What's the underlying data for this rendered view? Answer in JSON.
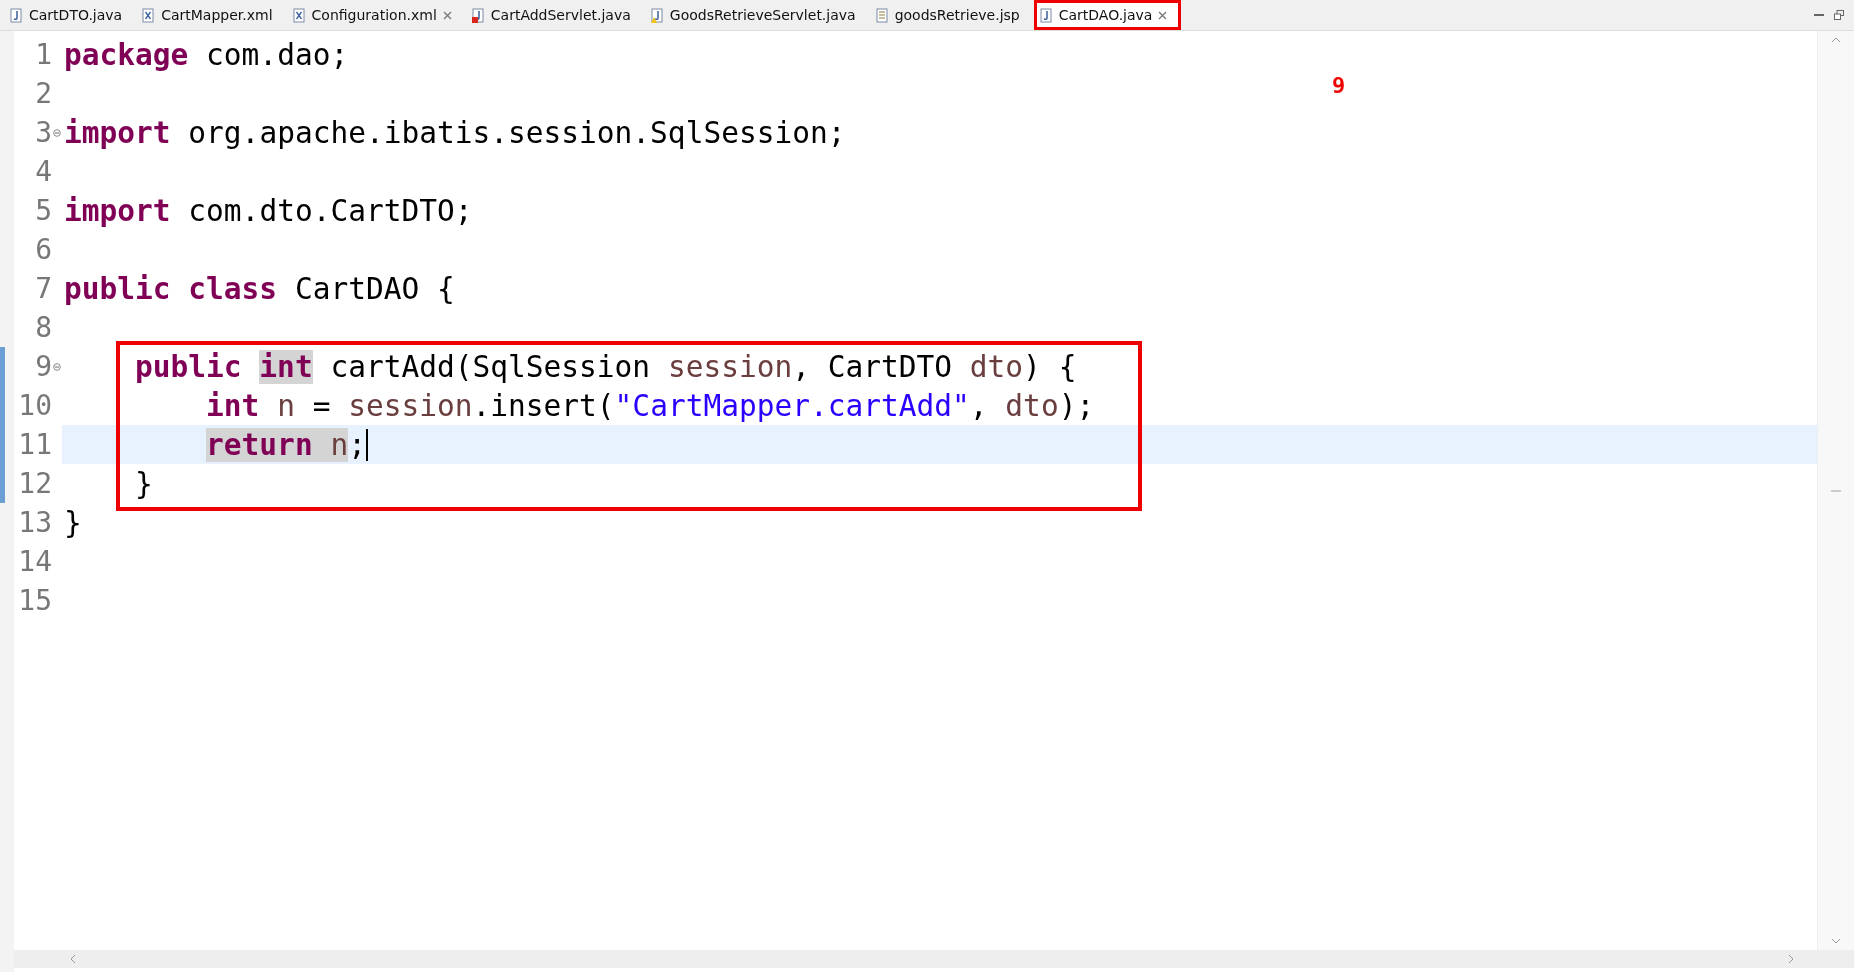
{
  "tabs": [
    {
      "label": "CartDTO.java",
      "kind": "java",
      "selected": false,
      "closable": false
    },
    {
      "label": "CartMapper.xml",
      "kind": "xml",
      "selected": false,
      "closable": false
    },
    {
      "label": "Configuration.xml",
      "kind": "xml",
      "selected": false,
      "closable": true
    },
    {
      "label": "CartAddServlet.java",
      "kind": "java",
      "error": true,
      "selected": false,
      "closable": false
    },
    {
      "label": "GoodsRetrieveServlet.java",
      "kind": "java",
      "warning": true,
      "selected": false,
      "closable": false
    },
    {
      "label": "goodsRetrieve.jsp",
      "kind": "jsp",
      "selected": false,
      "closable": false
    },
    {
      "label": "CartDAO.java",
      "kind": "java",
      "selected": true,
      "closable": true,
      "annotated": true
    }
  ],
  "annotation": {
    "label": "9"
  },
  "editor": {
    "lines": [
      {
        "number": "1",
        "tokens": [
          {
            "kind": "keyword",
            "text": "package",
            "highlighted": false
          },
          {
            "kind": "plain",
            "text": " com.dao;",
            "highlighted": false
          }
        ]
      },
      {
        "number": "2"
      },
      {
        "number": "3",
        "fold": true,
        "tokens": [
          {
            "kind": "keyword",
            "text": "import",
            "highlighted": false
          },
          {
            "kind": "plain",
            "text": " org.apache.ibatis.session.SqlSession;",
            "highlighted": false
          }
        ]
      },
      {
        "number": "4"
      },
      {
        "number": "5",
        "tokens": [
          {
            "kind": "keyword",
            "text": "import",
            "highlighted": false
          },
          {
            "kind": "plain",
            "text": " com.dto.CartDTO;",
            "highlighted": false
          }
        ]
      },
      {
        "number": "6"
      },
      {
        "number": "7",
        "tokens": [
          {
            "kind": "keyword",
            "text": "public class",
            "highlighted": false
          },
          {
            "kind": "plain",
            "text": " CartDAO {",
            "highlighted": false
          }
        ],
        "children": [
          {
            "number": "8"
          },
          {
            "number": "9",
            "fold": true,
            "changed": true,
            "annotated": true,
            "tokens": [
              {
                "kind": "keyword",
                "text": "public ",
                "highlighted": false
              },
              {
                "kind": "keyword",
                "text": "int",
                "highlighted": true
              },
              {
                "kind": "plain",
                "text": " cartAdd(SqlSession ",
                "highlighted": false
              },
              {
                "kind": "variable",
                "text": "session",
                "highlighted": false
              },
              {
                "kind": "plain",
                "text": ", CartDTO ",
                "highlighted": false
              },
              {
                "kind": "variable",
                "text": "dto",
                "highlighted": false
              },
              {
                "kind": "plain",
                "text": ") {",
                "highlighted": false
              }
            ],
            "children": [
              {
                "number": "10",
                "changed": true,
                "annotated": true,
                "tokens": [
                  {
                    "kind": "keyword",
                    "text": "int ",
                    "highlighted": false
                  },
                  {
                    "kind": "variable",
                    "text": "n",
                    "highlighted": false
                  },
                  {
                    "kind": "plain",
                    "text": " = ",
                    "highlighted": false
                  },
                  {
                    "kind": "variable",
                    "text": "session",
                    "highlighted": false
                  },
                  {
                    "kind": "plain",
                    "text": ".insert(",
                    "highlighted": false
                  },
                  {
                    "kind": "string",
                    "text": "\"CartMapper.cartAdd\"",
                    "highlighted": false
                  },
                  {
                    "kind": "plain",
                    "text": ", ",
                    "highlighted": false
                  },
                  {
                    "kind": "variable",
                    "text": "dto",
                    "highlighted": false
                  },
                  {
                    "kind": "plain",
                    "text": ");",
                    "highlighted": false
                  }
                ]
              },
              {
                "number": "11",
                "changed": true,
                "current": true,
                "annotated": true,
                "cursor": true,
                "tokens": [
                  {
                    "kind": "keyword",
                    "text": "return ",
                    "highlighted": true
                  },
                  {
                    "kind": "variable",
                    "text": "n",
                    "highlighted": true
                  },
                  {
                    "kind": "plain",
                    "text": ";",
                    "highlighted": false
                  }
                ]
              }
            ]
          },
          {
            "number": "12",
            "changed": true,
            "annotated": true,
            "tokens": [
              {
                "kind": "plain",
                "text": "}",
                "highlighted": false
              }
            ]
          }
        ]
      },
      {
        "number": "13",
        "tokens": [
          {
            "kind": "plain",
            "text": "}",
            "highlighted": false
          }
        ]
      },
      {
        "number": "14"
      },
      {
        "number": "15"
      }
    ]
  }
}
